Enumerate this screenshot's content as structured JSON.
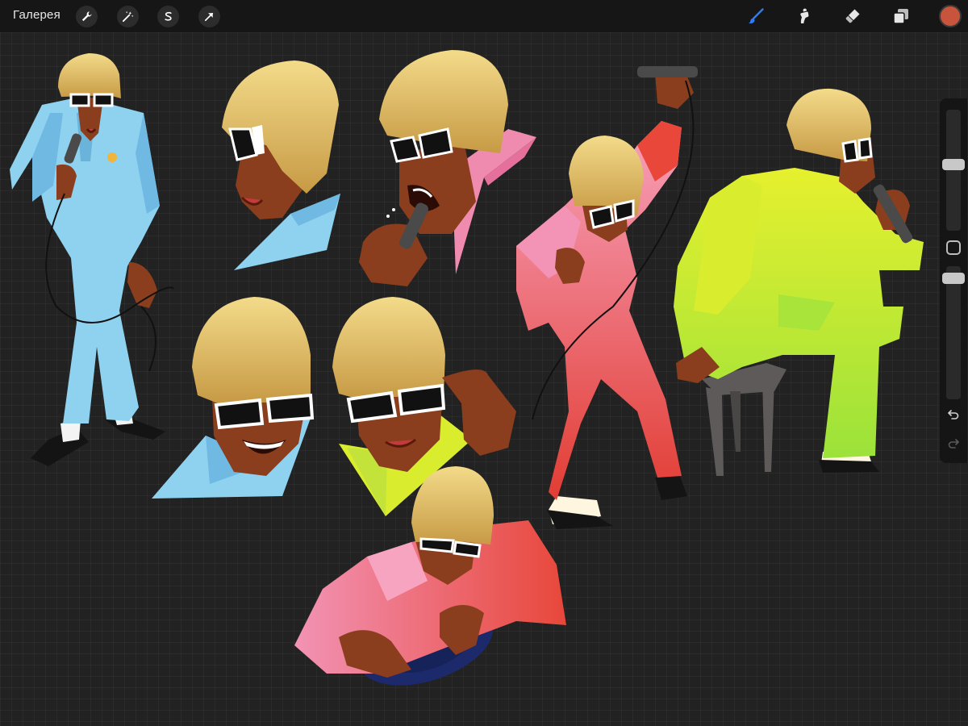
{
  "topbar": {
    "gallery_label": "Галерея",
    "left_tools": [
      {
        "icon": "wrench-icon",
        "name": "actions"
      },
      {
        "icon": "magic-wand-icon",
        "name": "adjustments"
      },
      {
        "icon": "selection-s-icon",
        "name": "selection"
      },
      {
        "icon": "arrow-cursor-icon",
        "name": "transform"
      }
    ],
    "right_tools": [
      {
        "icon": "brush-icon",
        "name": "brush",
        "active": true
      },
      {
        "icon": "smudge-icon",
        "name": "smudge"
      },
      {
        "icon": "eraser-icon",
        "name": "eraser"
      },
      {
        "icon": "layers-icon",
        "name": "layers"
      }
    ],
    "current_color": "#c8543c",
    "active_color": "#2f7cf6"
  },
  "sidebar": {
    "brush_size_level": 0.55,
    "opacity_level": 0.05,
    "icons": [
      "modifier-square-icon",
      "undo-icon",
      "redo-icon"
    ]
  },
  "colors": {
    "blue_suit": "#8fd2f0",
    "pink_suit": "#f08bb0",
    "red_suit": "#e8473a",
    "lime_suit": "#c9ee3a",
    "hair": "#e9c766",
    "skin": "#8a3e1d",
    "record": "#1c2a6c"
  }
}
